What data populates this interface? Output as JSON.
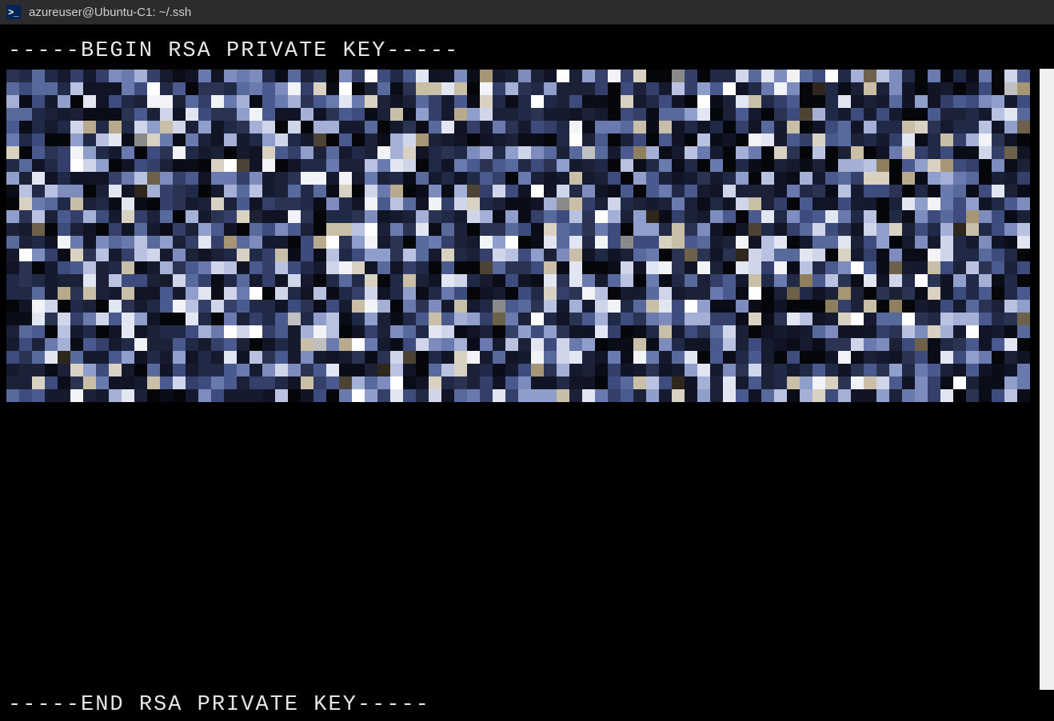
{
  "window": {
    "title": "azureuser@Ubuntu-C1: ~/.ssh",
    "icon_glyph": ">_"
  },
  "terminal": {
    "begin_marker": "-----BEGIN RSA PRIVATE KEY-----",
    "end_marker": "-----END RSA PRIVATE KEY-----",
    "body_status": "redacted-pixelated",
    "mosaic": {
      "cols": 80,
      "rows": 26,
      "block": 16
    }
  }
}
